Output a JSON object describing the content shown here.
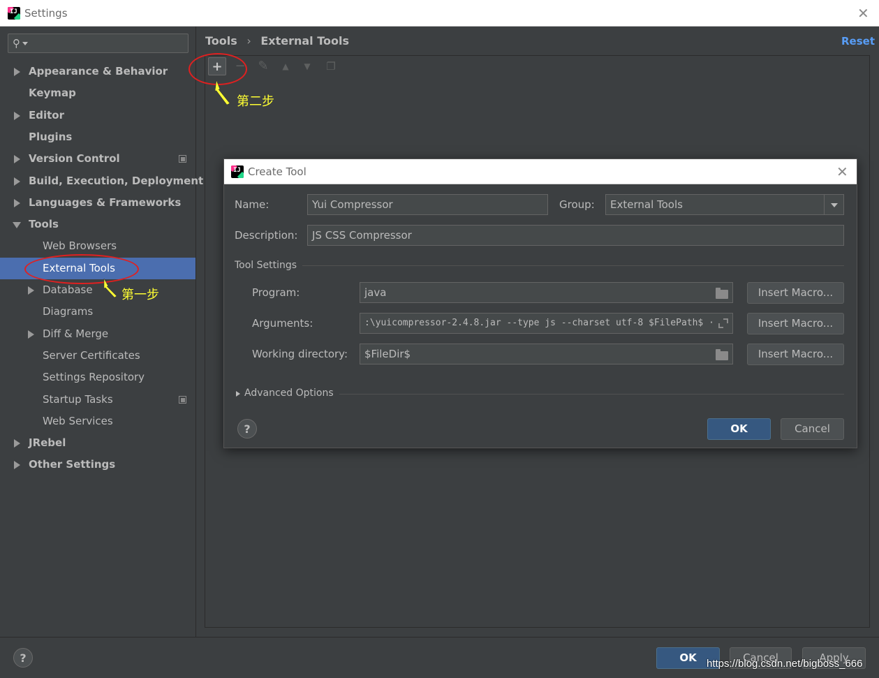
{
  "window": {
    "title": "Settings",
    "app_icon": "IJ"
  },
  "sidebar": {
    "search_placeholder": "",
    "items": [
      {
        "label": "Appearance & Behavior",
        "bold": true,
        "expander": "right"
      },
      {
        "label": "Keymap",
        "bold": true
      },
      {
        "label": "Editor",
        "bold": true,
        "expander": "right"
      },
      {
        "label": "Plugins",
        "bold": true
      },
      {
        "label": "Version Control",
        "bold": true,
        "expander": "right",
        "project_icon": true
      },
      {
        "label": "Build, Execution, Deployment",
        "bold": true,
        "expander": "right"
      },
      {
        "label": "Languages & Frameworks",
        "bold": true,
        "expander": "right"
      },
      {
        "label": "Tools",
        "bold": true,
        "expander": "down"
      },
      {
        "label": "Web Browsers"
      },
      {
        "label": "External Tools",
        "selected": true
      },
      {
        "label": "Database",
        "expander": "right"
      },
      {
        "label": "Diagrams"
      },
      {
        "label": "Diff & Merge",
        "expander": "right"
      },
      {
        "label": "Server Certificates"
      },
      {
        "label": "Settings Repository"
      },
      {
        "label": "Startup Tasks",
        "project_icon": true
      },
      {
        "label": "Web Services"
      },
      {
        "label": "JRebel",
        "bold": true,
        "expander": "right"
      },
      {
        "label": "Other Settings",
        "bold": true,
        "expander": "right"
      }
    ]
  },
  "main": {
    "breadcrumb": {
      "parent": "Tools",
      "separator": "›",
      "current": "External Tools"
    },
    "reset_label": "Reset",
    "toolbar_icons": [
      "add-icon",
      "remove-icon",
      "edit-icon",
      "move-up-icon",
      "move-down-icon",
      "copy-icon"
    ]
  },
  "dialog": {
    "title": "Create Tool",
    "name_label": "Name:",
    "name_value": "Yui Compressor",
    "group_label": "Group:",
    "group_value": "External Tools",
    "description_label": "Description:",
    "description_value": "JS CSS Compressor",
    "tool_settings_label": "Tool Settings",
    "program_label": "Program:",
    "program_value": "java",
    "arguments_label": "Arguments:",
    "arguments_value": ":\\yuicompressor-2.4.8.jar --type js --charset utf-8 $FilePath$ ·",
    "workdir_label": "Working directory:",
    "workdir_value": "$FileDir$",
    "insert_macro_label": "Insert Macro...",
    "advanced_label": "Advanced Options",
    "ok_label": "OK",
    "cancel_label": "Cancel",
    "help_label": "?"
  },
  "footer": {
    "help_label": "?",
    "ok_label": "OK",
    "cancel_label": "Cancel",
    "apply_label": "Apply"
  },
  "annotations": {
    "step1": "第一步",
    "step2": "第二步",
    "watermark": "https://blog.csdn.net/bigboss_666"
  },
  "colors": {
    "selection": "#4b6eaf",
    "link": "#589df6",
    "annotation_ring": "#e02020",
    "annotation_text": "#ffff33",
    "primary_button": "#365880"
  }
}
